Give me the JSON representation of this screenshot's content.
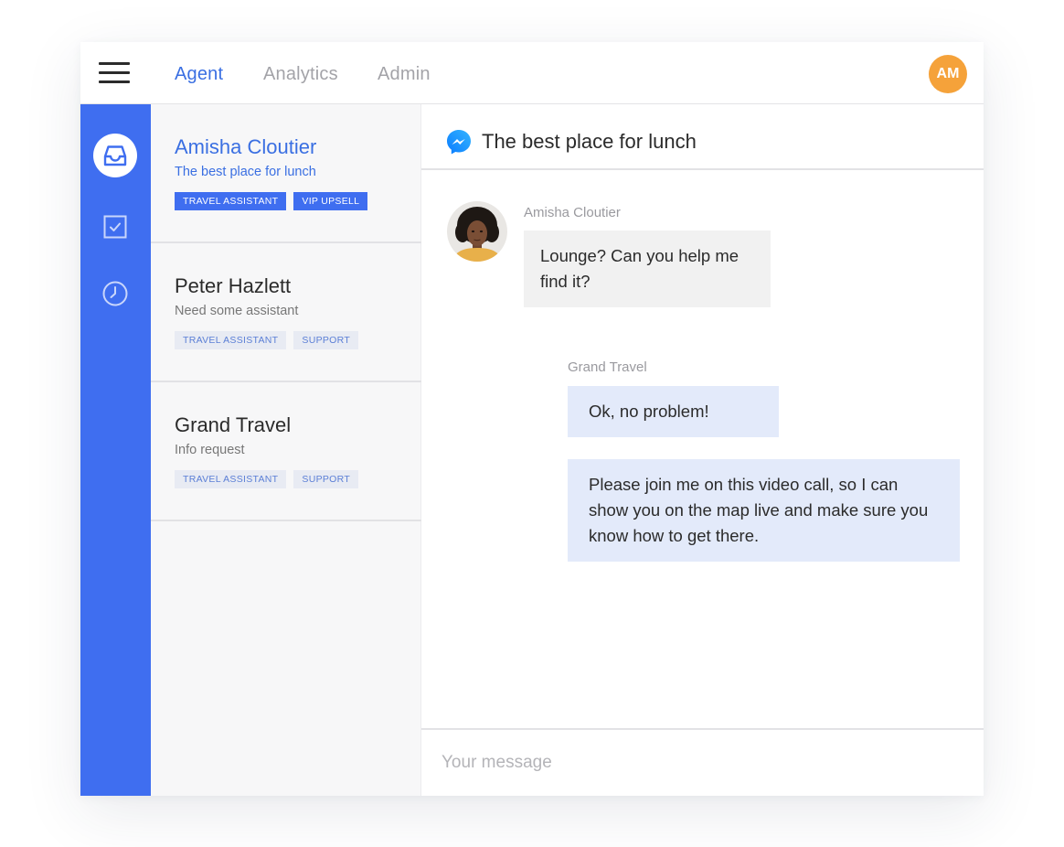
{
  "topbar": {
    "tabs": [
      {
        "label": "Agent",
        "active": true
      },
      {
        "label": "Analytics",
        "active": false
      },
      {
        "label": "Admin",
        "active": false
      }
    ],
    "user_initials": "AM"
  },
  "rail": {
    "items": [
      {
        "icon": "inbox-icon",
        "active": true
      },
      {
        "icon": "checkbox-icon",
        "active": false
      },
      {
        "icon": "clock-icon",
        "active": false
      }
    ]
  },
  "conversations": [
    {
      "name": "Amisha Cloutier",
      "subject": "The best place for lunch",
      "tags": [
        "TRAVEL ASSISTANT",
        "VIP UPSELL"
      ],
      "active": true
    },
    {
      "name": "Peter Hazlett",
      "subject": "Need some assistant",
      "tags": [
        "TRAVEL ASSISTANT",
        "SUPPORT"
      ],
      "active": false
    },
    {
      "name": "Grand Travel",
      "subject": "Info request",
      "tags": [
        "TRAVEL ASSISTANT",
        "SUPPORT"
      ],
      "active": false
    }
  ],
  "chat": {
    "channel_icon": "messenger-icon",
    "title": "The best place for lunch",
    "messages": [
      {
        "sender": "Amisha Cloutier",
        "text": "Lounge? Can you help me find it?"
      },
      {
        "sender": "Grand Travel",
        "text": "Ok, no problem!"
      },
      {
        "sender": "Grand Travel",
        "text": "Please join me on this video call, so I can show you on the map live and make sure you know how to get there."
      }
    ],
    "composer_placeholder": "Your message"
  },
  "colors": {
    "accent": "#3f6ef0",
    "link_blue": "#3a6fe2",
    "avatar_orange": "#f5a23a",
    "outgoing_bubble": "#e3eafa",
    "incoming_bubble": "#f1f1f1"
  }
}
